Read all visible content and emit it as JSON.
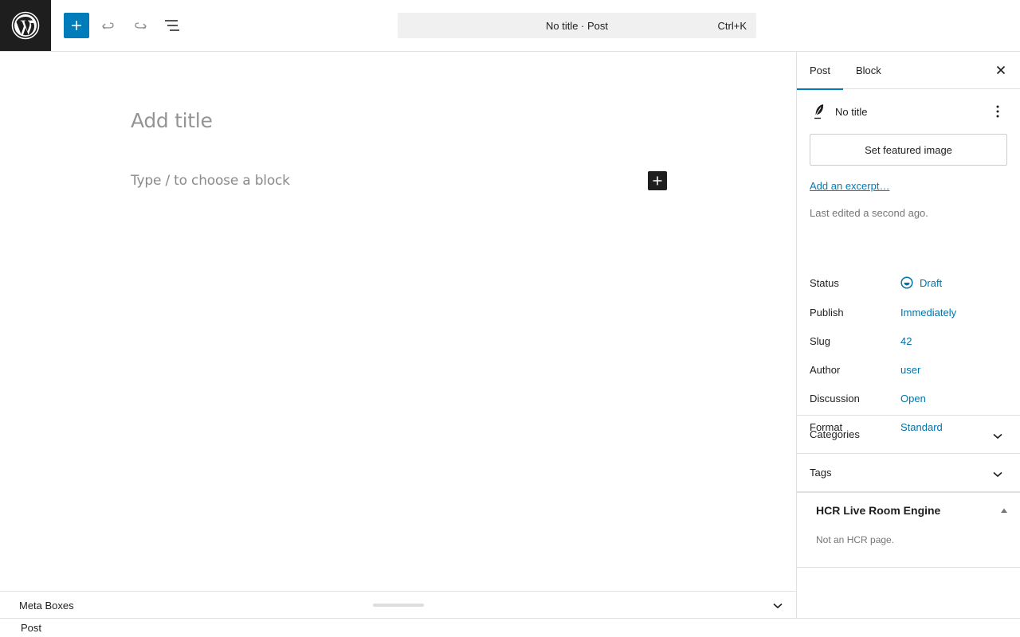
{
  "header": {
    "command_title": "No title · Post",
    "command_shortcut": "Ctrl+K"
  },
  "editor": {
    "title_placeholder": "Add title",
    "block_placeholder": "Type / to choose a block"
  },
  "metaboxes": {
    "label": "Meta Boxes"
  },
  "footer": {
    "breadcrumb": "Post"
  },
  "sidebar": {
    "tabs": [
      {
        "label": "Post",
        "active": true
      },
      {
        "label": "Block",
        "active": false
      }
    ],
    "post_title": "No title",
    "featured_image_label": "Set featured image",
    "excerpt_link": "Add an excerpt…",
    "last_edited": "Last edited a second ago.",
    "properties": [
      {
        "label": "Status",
        "value": "Draft"
      },
      {
        "label": "Publish",
        "value": "Immediately"
      },
      {
        "label": "Slug",
        "value": "42"
      },
      {
        "label": "Author",
        "value": "user"
      },
      {
        "label": "Discussion",
        "value": "Open"
      },
      {
        "label": "Format",
        "value": "Standard"
      }
    ],
    "panels": [
      {
        "label": "Categories"
      },
      {
        "label": "Tags"
      }
    ],
    "hcr": {
      "title": "HCR Live Room Engine",
      "note": "Not an HCR page."
    }
  },
  "colors": {
    "accent": "#007cba",
    "link": "#0073aa",
    "dark": "#1e1e1e"
  }
}
